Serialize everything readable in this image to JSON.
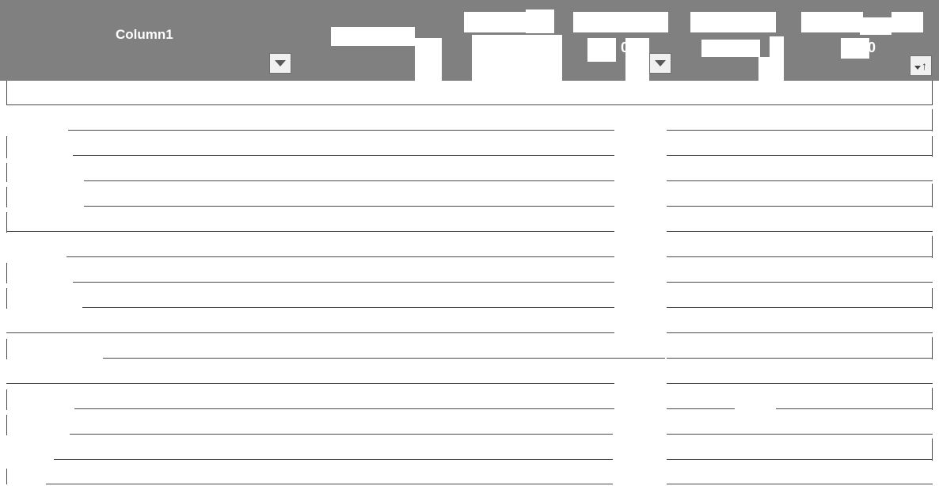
{
  "table": {
    "columns": [
      {
        "label": "Column1"
      },
      {
        "label": ""
      },
      {
        "label": ""
      },
      {
        "label": ""
      },
      {
        "label": ""
      },
      {
        "label": ""
      }
    ],
    "header_fragments": [
      "0",
      "0"
    ]
  },
  "colors": {
    "header_bg": "#808080",
    "header_text": "#ffffff",
    "grid_line": "#4a4a4a"
  },
  "icons": {
    "filter": "dropdown-triangle-icon",
    "sort": "sort-ascending-icon"
  }
}
